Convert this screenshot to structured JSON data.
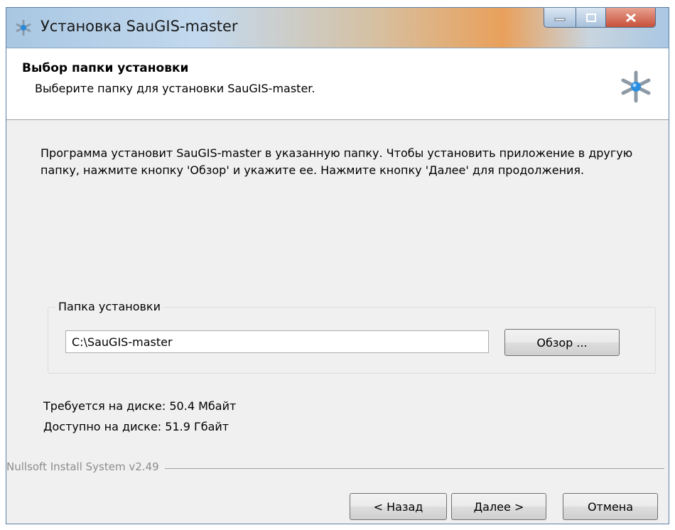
{
  "window": {
    "title": "Установка SauGIS-master"
  },
  "header": {
    "title": "Выбор папки установки",
    "subtitle": "Выберите папку для установки SauGIS-master."
  },
  "description": "Программа установит SauGIS-master в указанную папку. Чтобы установить приложение в другую папку, нажмите кнопку 'Обзор' и укажите ее. Нажмите кнопку 'Далее' для продолжения.",
  "folder_group": {
    "label": "Папка установки",
    "path_value": "C:\\SauGIS-master",
    "browse_label": "Обзор ..."
  },
  "space": {
    "required": "Требуется на диске: 50.4 Мбайт",
    "available": "Доступно на диске: 51.9 Гбайт"
  },
  "footer": {
    "brand": "Nullsoft Install System v2.49",
    "back_label": "< Назад",
    "next_label": "Далее >",
    "cancel_label": "Отмена"
  },
  "icons": {
    "title": "installer-icon",
    "header": "installer-icon",
    "minimize": "minimize-icon",
    "maximize": "maximize-icon",
    "close": "close-icon"
  },
  "colors": {
    "close_button": "#c7503a",
    "window_bg": "#f0f0f0",
    "header_bg": "#ffffff"
  }
}
